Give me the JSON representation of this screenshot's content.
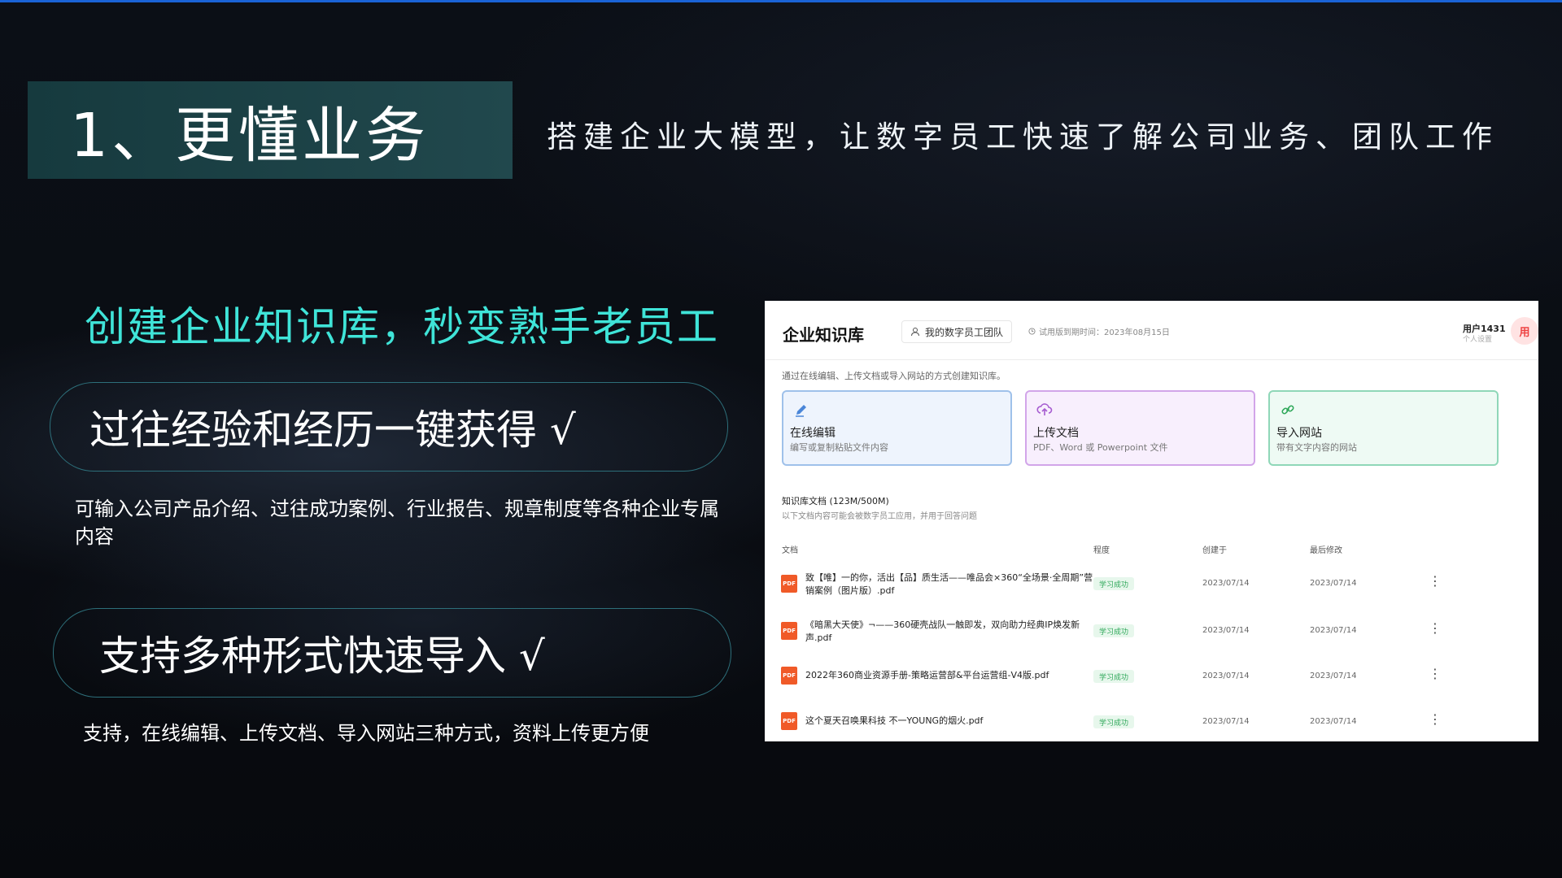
{
  "slide": {
    "title": "1、更懂业务",
    "subtitle": "搭建企业大模型，让数字员工快速了解公司业务、团队工作",
    "heading": "创建企业知识库，秒变熟手老员工",
    "point1": "过往经验和经历一键获得 √",
    "desc1": "可输入公司产品介绍、过往成功案例、行业报告、规章制度等各种企业专属内容",
    "point2": "支持多种形式快速导入 √",
    "desc2": "支持，在线编辑、上传文档、导入网站三种方式，资料上传更方便"
  },
  "app": {
    "title": "企业知识库",
    "team": "我的数字员工团队",
    "trial": "试用版到期时间：2023年08月15日",
    "user_name": "用户1431",
    "user_sub": "个人设置",
    "avatar": "用",
    "hint": "通过在线编辑、上传文档或导入网站的方式创建知识库。",
    "cards": [
      {
        "title": "在线编辑",
        "desc": "编写或复制粘贴文件内容",
        "icon": "pencil-icon"
      },
      {
        "title": "上传文档",
        "desc": "PDF、Word 或 Powerpoint 文件",
        "icon": "cloud-upload-icon"
      },
      {
        "title": "导入网站",
        "desc": "带有文字内容的网站",
        "icon": "link-icon"
      }
    ],
    "library_title": "知识库文档 (123M/500M)",
    "library_sub": "以下文档内容可能会被数字员工应用，并用于回答问题",
    "columns": [
      "文档",
      "程度",
      "创建于",
      "最后修改"
    ],
    "rows": [
      {
        "name": "致【唯】一的你，活出【品】质生活——唯品会×360“全场景·全周期”营销案例（图片版）.pdf",
        "status": "学习成功",
        "created": "2023/07/14",
        "modified": "2023/07/14"
      },
      {
        "name": "《暗黑大天使》¬——360硬壳战队一触即发，双向助力经典IP焕发新声.pdf",
        "status": "学习成功",
        "created": "2023/07/14",
        "modified": "2023/07/14"
      },
      {
        "name": "2022年360商业资源手册-策略运营部&平台运营组-V4版.pdf",
        "status": "学习成功",
        "created": "2023/07/14",
        "modified": "2023/07/14"
      },
      {
        "name": "这个夏天召唤果科技 不一YOUNG的烟火.pdf",
        "status": "学习成功",
        "created": "2023/07/14",
        "modified": "2023/07/14"
      }
    ],
    "pdf_label": "PDF",
    "more_glyph": "⋮"
  }
}
